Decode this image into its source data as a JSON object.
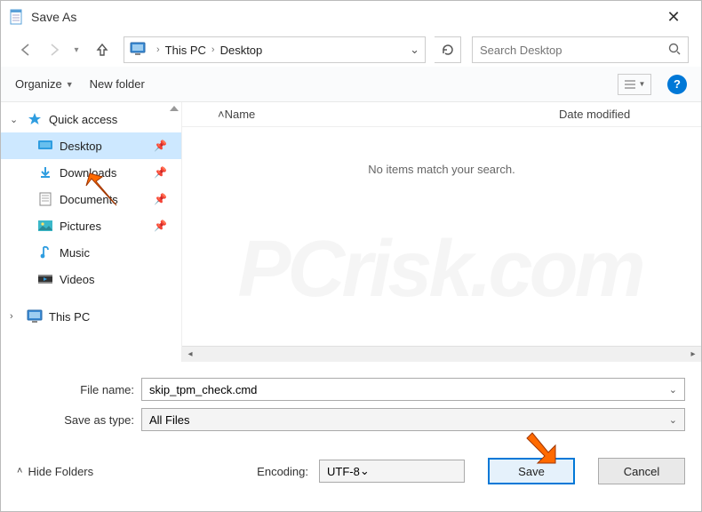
{
  "title": "Save As",
  "breadcrumb": {
    "root": "This PC",
    "current": "Desktop"
  },
  "search": {
    "placeholder": "Search Desktop"
  },
  "toolbar": {
    "organize": "Organize",
    "newfolder": "New folder"
  },
  "tree": {
    "quickaccess": "Quick access",
    "items": [
      {
        "label": "Desktop"
      },
      {
        "label": "Downloads"
      },
      {
        "label": "Documents"
      },
      {
        "label": "Pictures"
      },
      {
        "label": "Music"
      },
      {
        "label": "Videos"
      }
    ],
    "thispc": "This PC"
  },
  "columns": {
    "name": "Name",
    "date": "Date modified"
  },
  "empty_message": "No items match your search.",
  "fields": {
    "filename_label": "File name:",
    "filename_value": "skip_tpm_check.cmd",
    "savetype_label": "Save as type:",
    "savetype_value": "All Files"
  },
  "encoding": {
    "label": "Encoding:",
    "value": "UTF-8"
  },
  "buttons": {
    "save": "Save",
    "cancel": "Cancel",
    "hidefolders": "Hide Folders"
  }
}
